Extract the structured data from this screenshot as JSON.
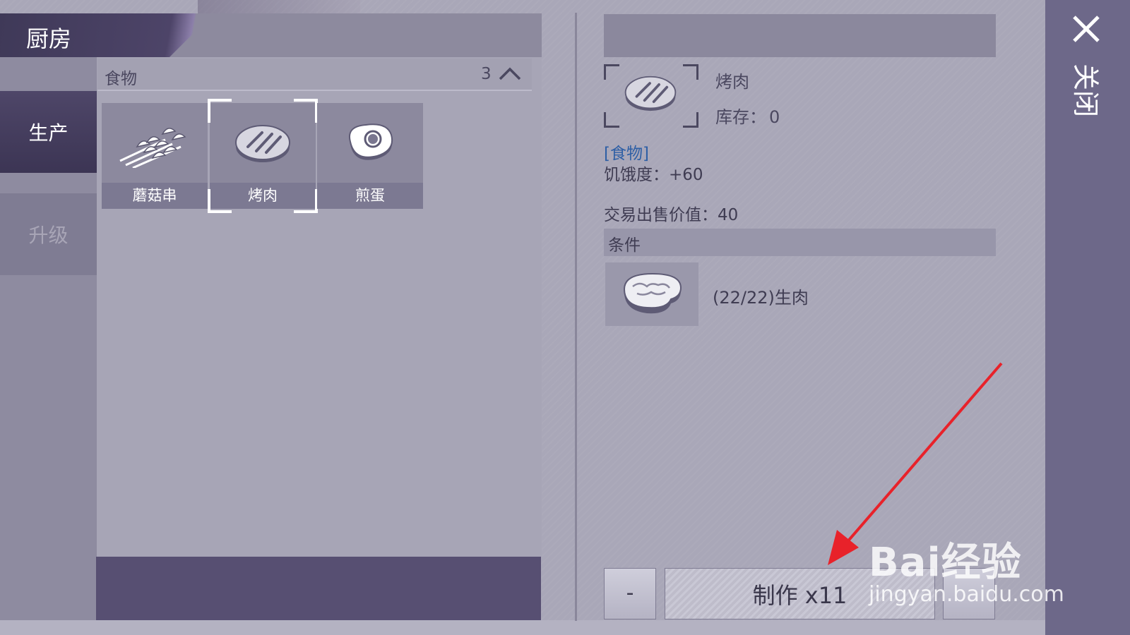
{
  "window": {
    "title": "厨房"
  },
  "side_tabs": [
    {
      "label": "生产",
      "active": true
    },
    {
      "label": "升级",
      "active": false
    }
  ],
  "category": {
    "label": "食物",
    "count": "3",
    "chevron_icon": "chevron-up-icon"
  },
  "recipes": [
    {
      "label": "蘑菇串",
      "icon": "mushroom-skewer-icon",
      "selected": false
    },
    {
      "label": "烤肉",
      "icon": "grilled-meat-icon",
      "selected": true
    },
    {
      "label": "煎蛋",
      "icon": "fried-egg-icon",
      "selected": false
    }
  ],
  "detail": {
    "name": "烤肉",
    "stock_label": "库存：",
    "stock_value": "0",
    "tag": "[食物]",
    "hunger": "饥饿度：+60",
    "price": "交易出售价值：40",
    "conditions_label": "条件",
    "condition": {
      "text": "(22/22)生肉",
      "icon": "raw-meat-icon"
    }
  },
  "actions": {
    "minus_label": "-",
    "make_label": "制作 x11",
    "plus_label": "+"
  },
  "close": {
    "label": "关闭",
    "icon": "close-icon"
  },
  "watermark": {
    "brand": "Bai经验",
    "url": "jingyan.baidu.com"
  },
  "colors": {
    "panel_dark": "#574f72",
    "accent_purple": "#4e4668",
    "tag_blue": "#2e5fa5",
    "arrow_red": "#e8222a"
  }
}
